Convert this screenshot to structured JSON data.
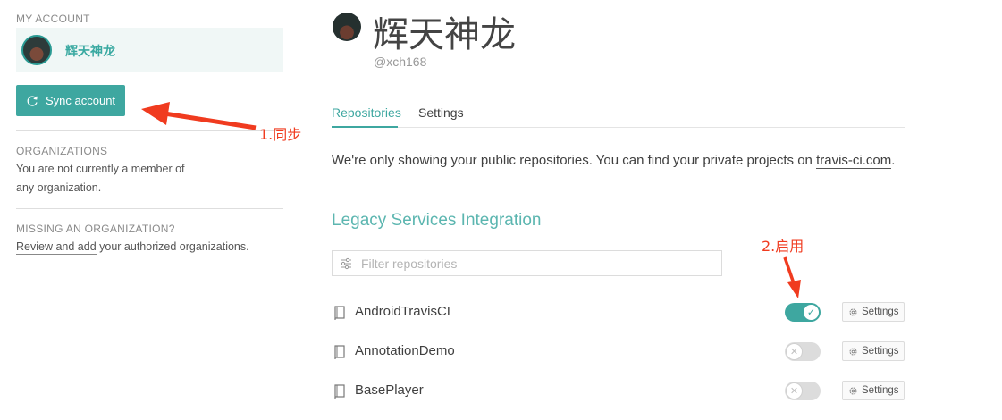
{
  "sidebar": {
    "my_account_heading": "MY ACCOUNT",
    "account_name": "辉天神龙",
    "sync_button_label": "Sync account",
    "organizations_heading": "ORGANIZATIONS",
    "organizations_text_1": "You are not currently a member of",
    "organizations_text_2": "any organization.",
    "missing_org_heading": "MISSING AN ORGANIZATION?",
    "missing_org_link": "Review and add",
    "missing_org_rest": " your authorized organizations."
  },
  "annotations": {
    "sync_note": "1.同步",
    "enable_note": "2.启用",
    "color": "#f03b1f"
  },
  "profile": {
    "display_name": "辉天神龙",
    "handle": "@xch168"
  },
  "tabs": [
    {
      "label": "Repositories",
      "active": true
    },
    {
      "label": "Settings",
      "active": false
    }
  ],
  "notice": {
    "text": "We're only showing your public repositories. You can find your private projects on ",
    "link": "travis-ci.com",
    "suffix": "."
  },
  "section_title": "Legacy Services Integration",
  "filter": {
    "placeholder": "Filter repositories",
    "value": ""
  },
  "repositories": [
    {
      "name": "AndroidTravisCI",
      "enabled": true,
      "settings_label": "Settings"
    },
    {
      "name": "AnnotationDemo",
      "enabled": false,
      "settings_label": "Settings"
    },
    {
      "name": "BasePlayer",
      "enabled": false,
      "settings_label": "Settings"
    }
  ],
  "colors": {
    "accent": "#3ea7a0",
    "accent_light": "#5cb6b0",
    "account_card_bg": "#f0f7f6",
    "toggle_off": "#dcdcdc"
  }
}
